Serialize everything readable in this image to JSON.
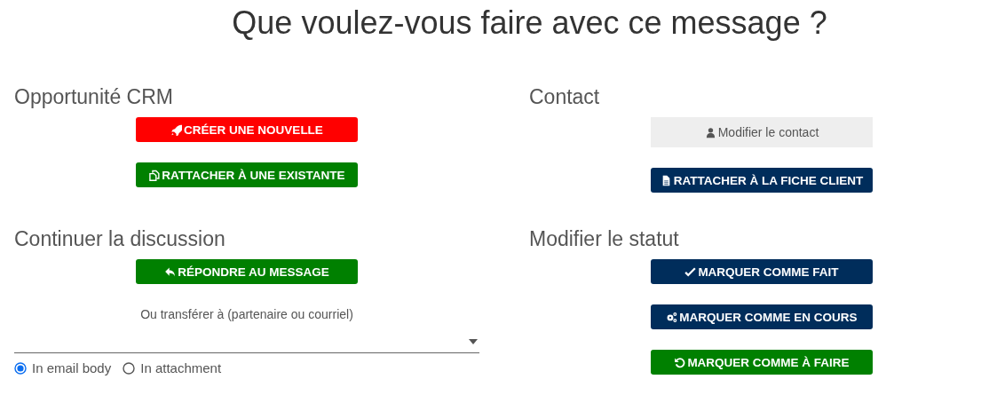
{
  "title": "Que voulez-vous faire avec ce message ?",
  "sections": [
    {
      "heading": "Opportunité CRM",
      "buttons": [
        {
          "label": "CRÉER UNE NOUVELLE"
        },
        {
          "label": "RATTACHER À UNE EXISTANTE"
        }
      ]
    },
    {
      "heading": "Contact",
      "buttons": [
        {
          "label": "Modifier le contact"
        },
        {
          "label": "RATTACHER À LA FICHE CLIENT"
        }
      ]
    },
    {
      "heading": "Continuer la discussion",
      "buttons": [
        {
          "label": "RÉPONDRE AU MESSAGE"
        }
      ],
      "forward": {
        "label": "Ou transférer à (partenaire ou courriel)",
        "options": [
          {
            "label": "In email body",
            "selected": true
          },
          {
            "label": "In attachment",
            "selected": false
          }
        ]
      }
    },
    {
      "heading": "Modifier le statut",
      "buttons": [
        {
          "label": "MARQUER COMME FAIT"
        },
        {
          "label": "MARQUER COMME EN COURS"
        },
        {
          "label": "MARQUER COMME À FAIRE"
        }
      ]
    }
  ]
}
